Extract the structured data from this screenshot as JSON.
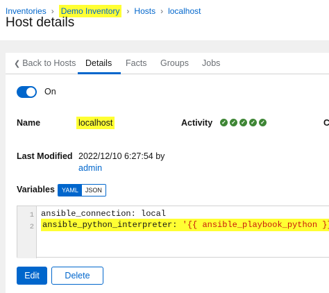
{
  "breadcrumb": {
    "items": [
      "Inventories",
      "Demo Inventory",
      "Hosts",
      "localhost"
    ],
    "separator": "›"
  },
  "page_title": "Host details",
  "tabs": {
    "back": "Back to Hosts",
    "back_icon": "chevron-left-icon",
    "items": [
      "Details",
      "Facts",
      "Groups",
      "Jobs"
    ],
    "active": "Details"
  },
  "enabled_toggle": {
    "state": "on",
    "label": "On"
  },
  "details": {
    "name_label": "Name",
    "name_value": "localhost",
    "activity_label": "Activity",
    "activity_statuses": [
      "success",
      "success",
      "success",
      "success",
      "success"
    ],
    "activity_icon": "✓",
    "clipped_label": "C",
    "last_modified_label": "Last Modified",
    "last_modified_value": "2022/12/10 6:27:54 by",
    "last_modified_user": "admin"
  },
  "variables": {
    "label": "Variables",
    "modes": [
      "YAML",
      "JSON"
    ],
    "selected_mode": "YAML",
    "lines": [
      {
        "number": "1",
        "key": "ansible_connection: ",
        "value": "local"
      },
      {
        "number": "2",
        "key": "ansible_python_interpreter: ",
        "value": "'{{ ansible_playbook_python }}'"
      }
    ]
  },
  "actions": {
    "edit": "Edit",
    "delete": "Delete"
  },
  "colors": {
    "accent": "#0066cc",
    "success": "#3e8635",
    "highlight": "#ffff33",
    "string": "#c9190b"
  }
}
